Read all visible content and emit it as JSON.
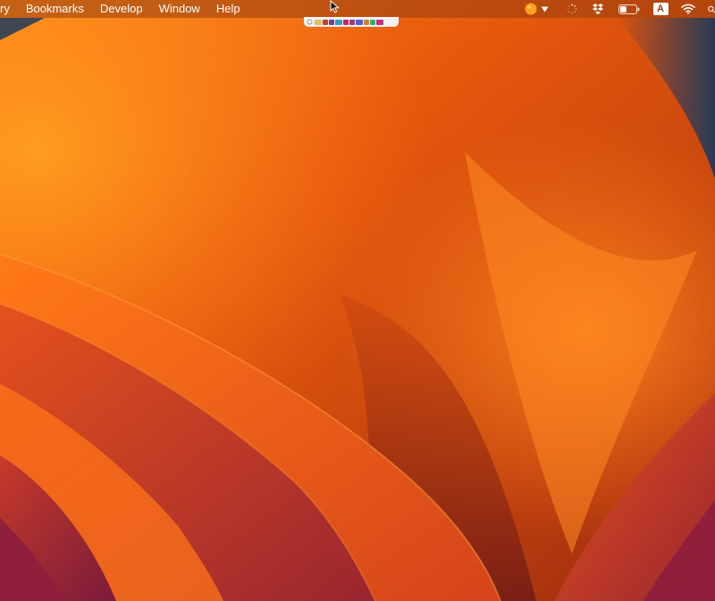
{
  "menubar": {
    "items": [
      {
        "label": "ry"
      },
      {
        "label": "Bookmarks"
      },
      {
        "label": "Develop"
      },
      {
        "label": "Window"
      },
      {
        "label": "Help"
      }
    ],
    "status": {
      "app_indicator_icon": "orange-circle-icon",
      "dropdown_icon": "chevron-down-icon",
      "spinner_icon": "loading-spinner-icon",
      "dropbox_icon": "dropbox-icon",
      "battery_icon": "battery-icon",
      "battery_level": 0.4,
      "input_source_label": "A",
      "wifi_icon": "wifi-icon",
      "search_icon": "spotlight-search-icon"
    }
  },
  "palette": {
    "icon": "palette-strip-icon",
    "swatch_colors": [
      "#e0c060",
      "#c04020",
      "#7040a0",
      "#30a0c0",
      "#d02060",
      "#904080",
      "#5060d0",
      "#d08030",
      "#30b070",
      "#c03080"
    ]
  },
  "wallpaper": {
    "name": "macOS Ventura orange wallpaper",
    "colors": {
      "base": "#c2420d",
      "bright": "#ff7a1a",
      "dark": "#7a1d16",
      "magenta": "#8f1f3a",
      "navy": "#1f3a5c"
    }
  }
}
